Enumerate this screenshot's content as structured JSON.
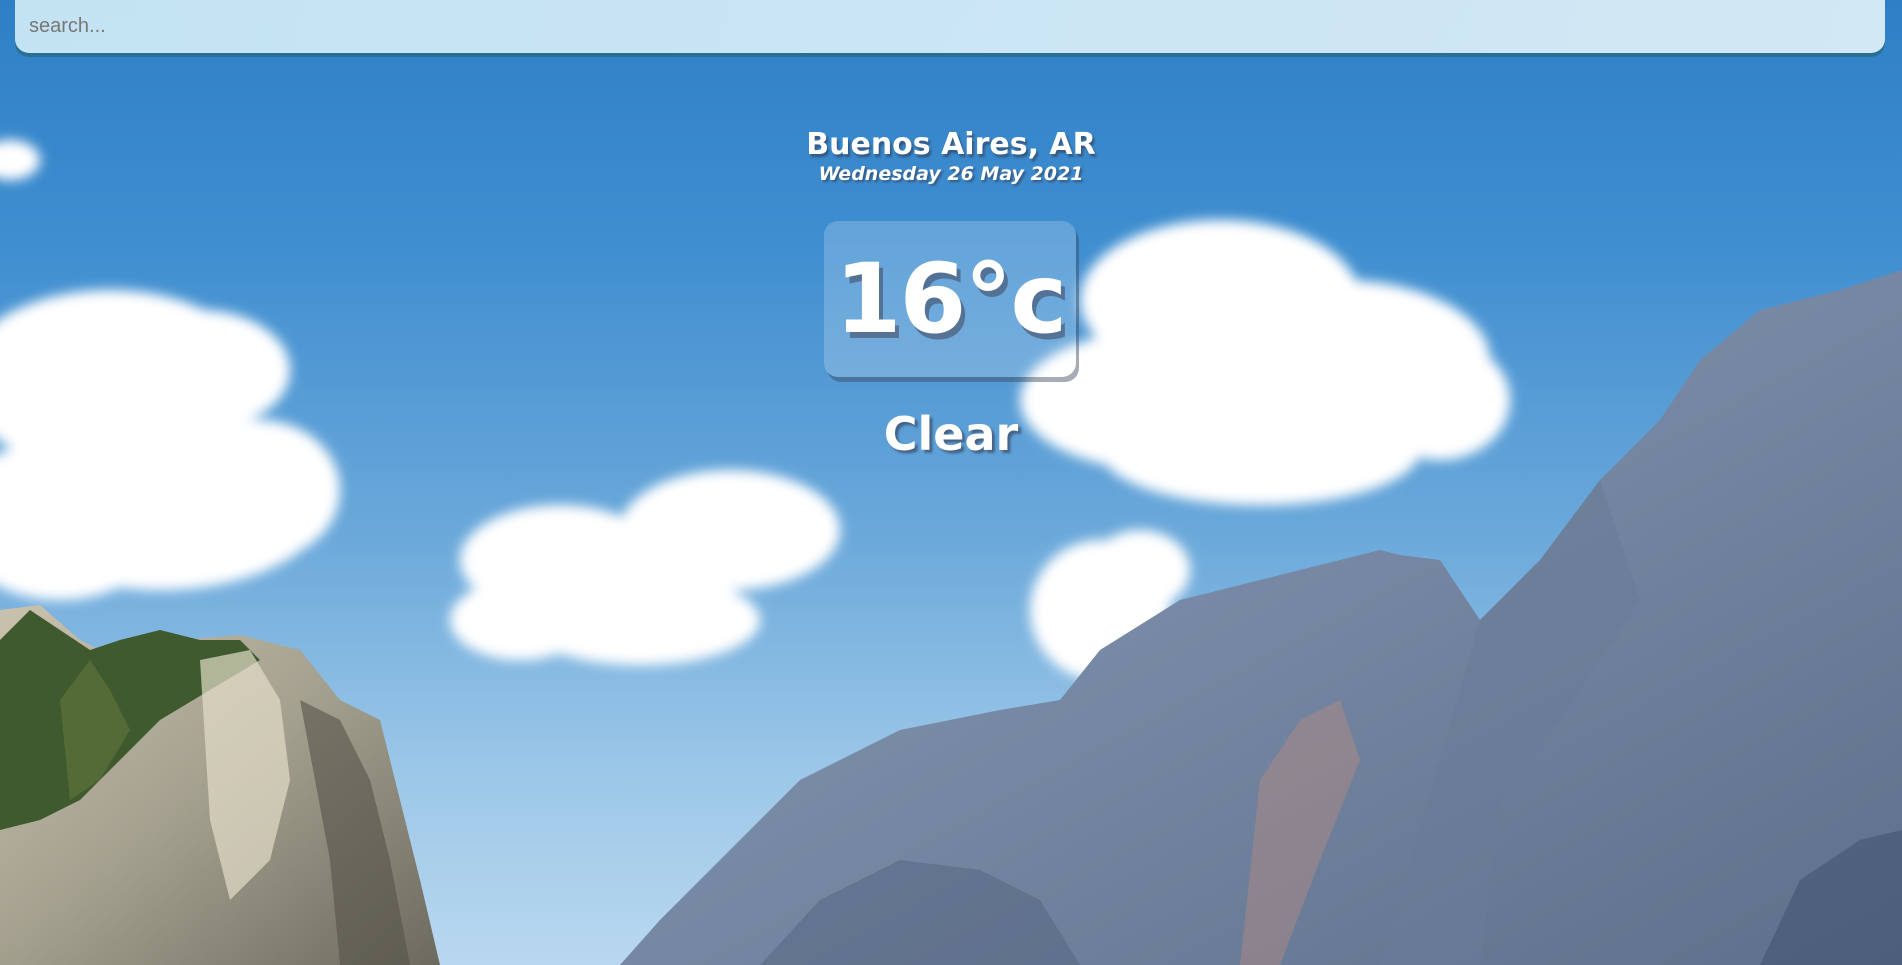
{
  "search": {
    "placeholder": "search...",
    "value": ""
  },
  "location": {
    "city_country": "Buenos Aires, AR",
    "date": "Wednesday 26 May 2021"
  },
  "weather": {
    "temperature": "16°c",
    "condition": "Clear"
  },
  "background": {
    "sky_color": "#3f8ed0",
    "cloud_color": "#ffffff",
    "rock_color": "#7d8fa8"
  }
}
